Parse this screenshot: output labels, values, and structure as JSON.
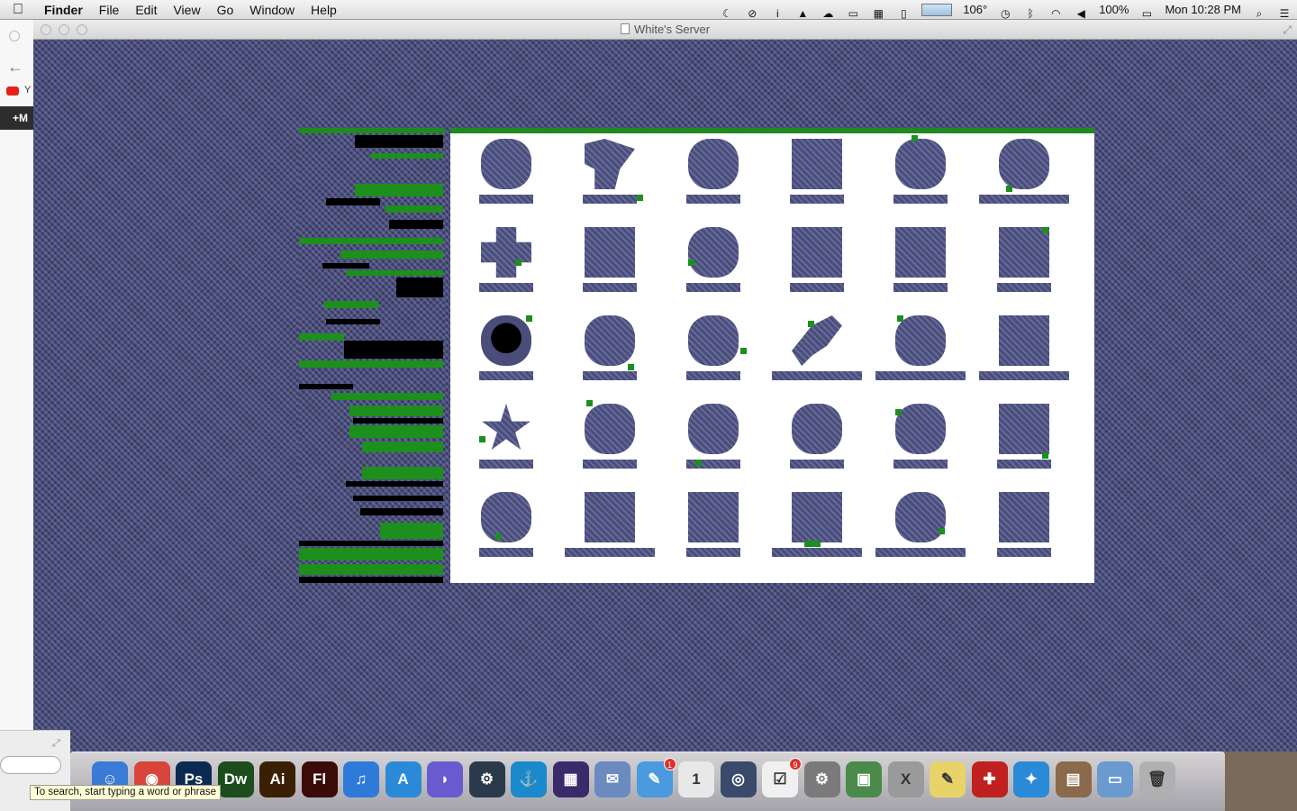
{
  "menubar": {
    "app": "Finder",
    "items": [
      "File",
      "Edit",
      "View",
      "Go",
      "Window",
      "Help"
    ],
    "temperature": "106°",
    "battery": "100%",
    "clock": "Mon 10:28 PM"
  },
  "background_browser": {
    "youtube_label": "Y",
    "gbar_label": "+M"
  },
  "window": {
    "title": "White's Server"
  },
  "dock": {
    "apps": [
      {
        "name": "Finder",
        "glyph": "☺",
        "color": "#3a7bd5"
      },
      {
        "name": "Chrome",
        "glyph": "◉",
        "color": "#d9443b"
      },
      {
        "name": "Photoshop",
        "glyph": "Ps",
        "color": "#0b2a52"
      },
      {
        "name": "Dreamweaver",
        "glyph": "Dw",
        "color": "#1d4d1d"
      },
      {
        "name": "Illustrator",
        "glyph": "Ai",
        "color": "#3a1f05"
      },
      {
        "name": "Flash",
        "glyph": "Fl",
        "color": "#3b0b07"
      },
      {
        "name": "iTunes",
        "glyph": "♫",
        "color": "#2f7ad9"
      },
      {
        "name": "App Store",
        "glyph": "A",
        "color": "#2a8ad8"
      },
      {
        "name": "BitTorrent",
        "glyph": "◗",
        "color": "#6a5ad0"
      },
      {
        "name": "Steam",
        "glyph": "⚙",
        "color": "#2a3a4a"
      },
      {
        "name": "Transmission",
        "glyph": "⚓",
        "color": "#1a8acc"
      },
      {
        "name": "Grid App",
        "glyph": "▦",
        "color": "#3a2a6a"
      },
      {
        "name": "Mail",
        "glyph": "✉",
        "color": "#6a8ac0"
      },
      {
        "name": "Messages",
        "glyph": "✎",
        "color": "#4a9ae0"
      },
      {
        "name": "Calendar",
        "glyph": "1",
        "color": "#e8e8e8"
      },
      {
        "name": "Photo Booth",
        "glyph": "◎",
        "color": "#3a4a6a"
      },
      {
        "name": "Reminders",
        "glyph": "☑",
        "color": "#f0f0f0"
      },
      {
        "name": "System Preferences",
        "glyph": "⚙",
        "color": "#7a7a7a"
      },
      {
        "name": "Preview",
        "glyph": "▣",
        "color": "#4a8a4a"
      },
      {
        "name": "X11",
        "glyph": "X",
        "color": "#9a9a9a"
      },
      {
        "name": "Stickies",
        "glyph": "✎",
        "color": "#e8d36a"
      },
      {
        "name": "Game",
        "glyph": "✚",
        "color": "#c02020"
      },
      {
        "name": "Safari",
        "glyph": "✦",
        "color": "#2a8ad8"
      },
      {
        "name": "Images Folder",
        "glyph": "▤",
        "color": "#8a6a4a"
      },
      {
        "name": "Downloads Folder",
        "glyph": "▭",
        "color": "#6a9ad0"
      },
      {
        "name": "Trash",
        "glyph": "🗑",
        "color": "#b0b0b0"
      }
    ],
    "badges": {
      "Messages": "1",
      "Reminders": "9"
    }
  },
  "tooltip": "To search, start typing a word or phrase",
  "colors": {
    "game_bg": "#4a4d7a",
    "game_green": "#1c8f1c",
    "inventory_bg": "#ffffff"
  }
}
